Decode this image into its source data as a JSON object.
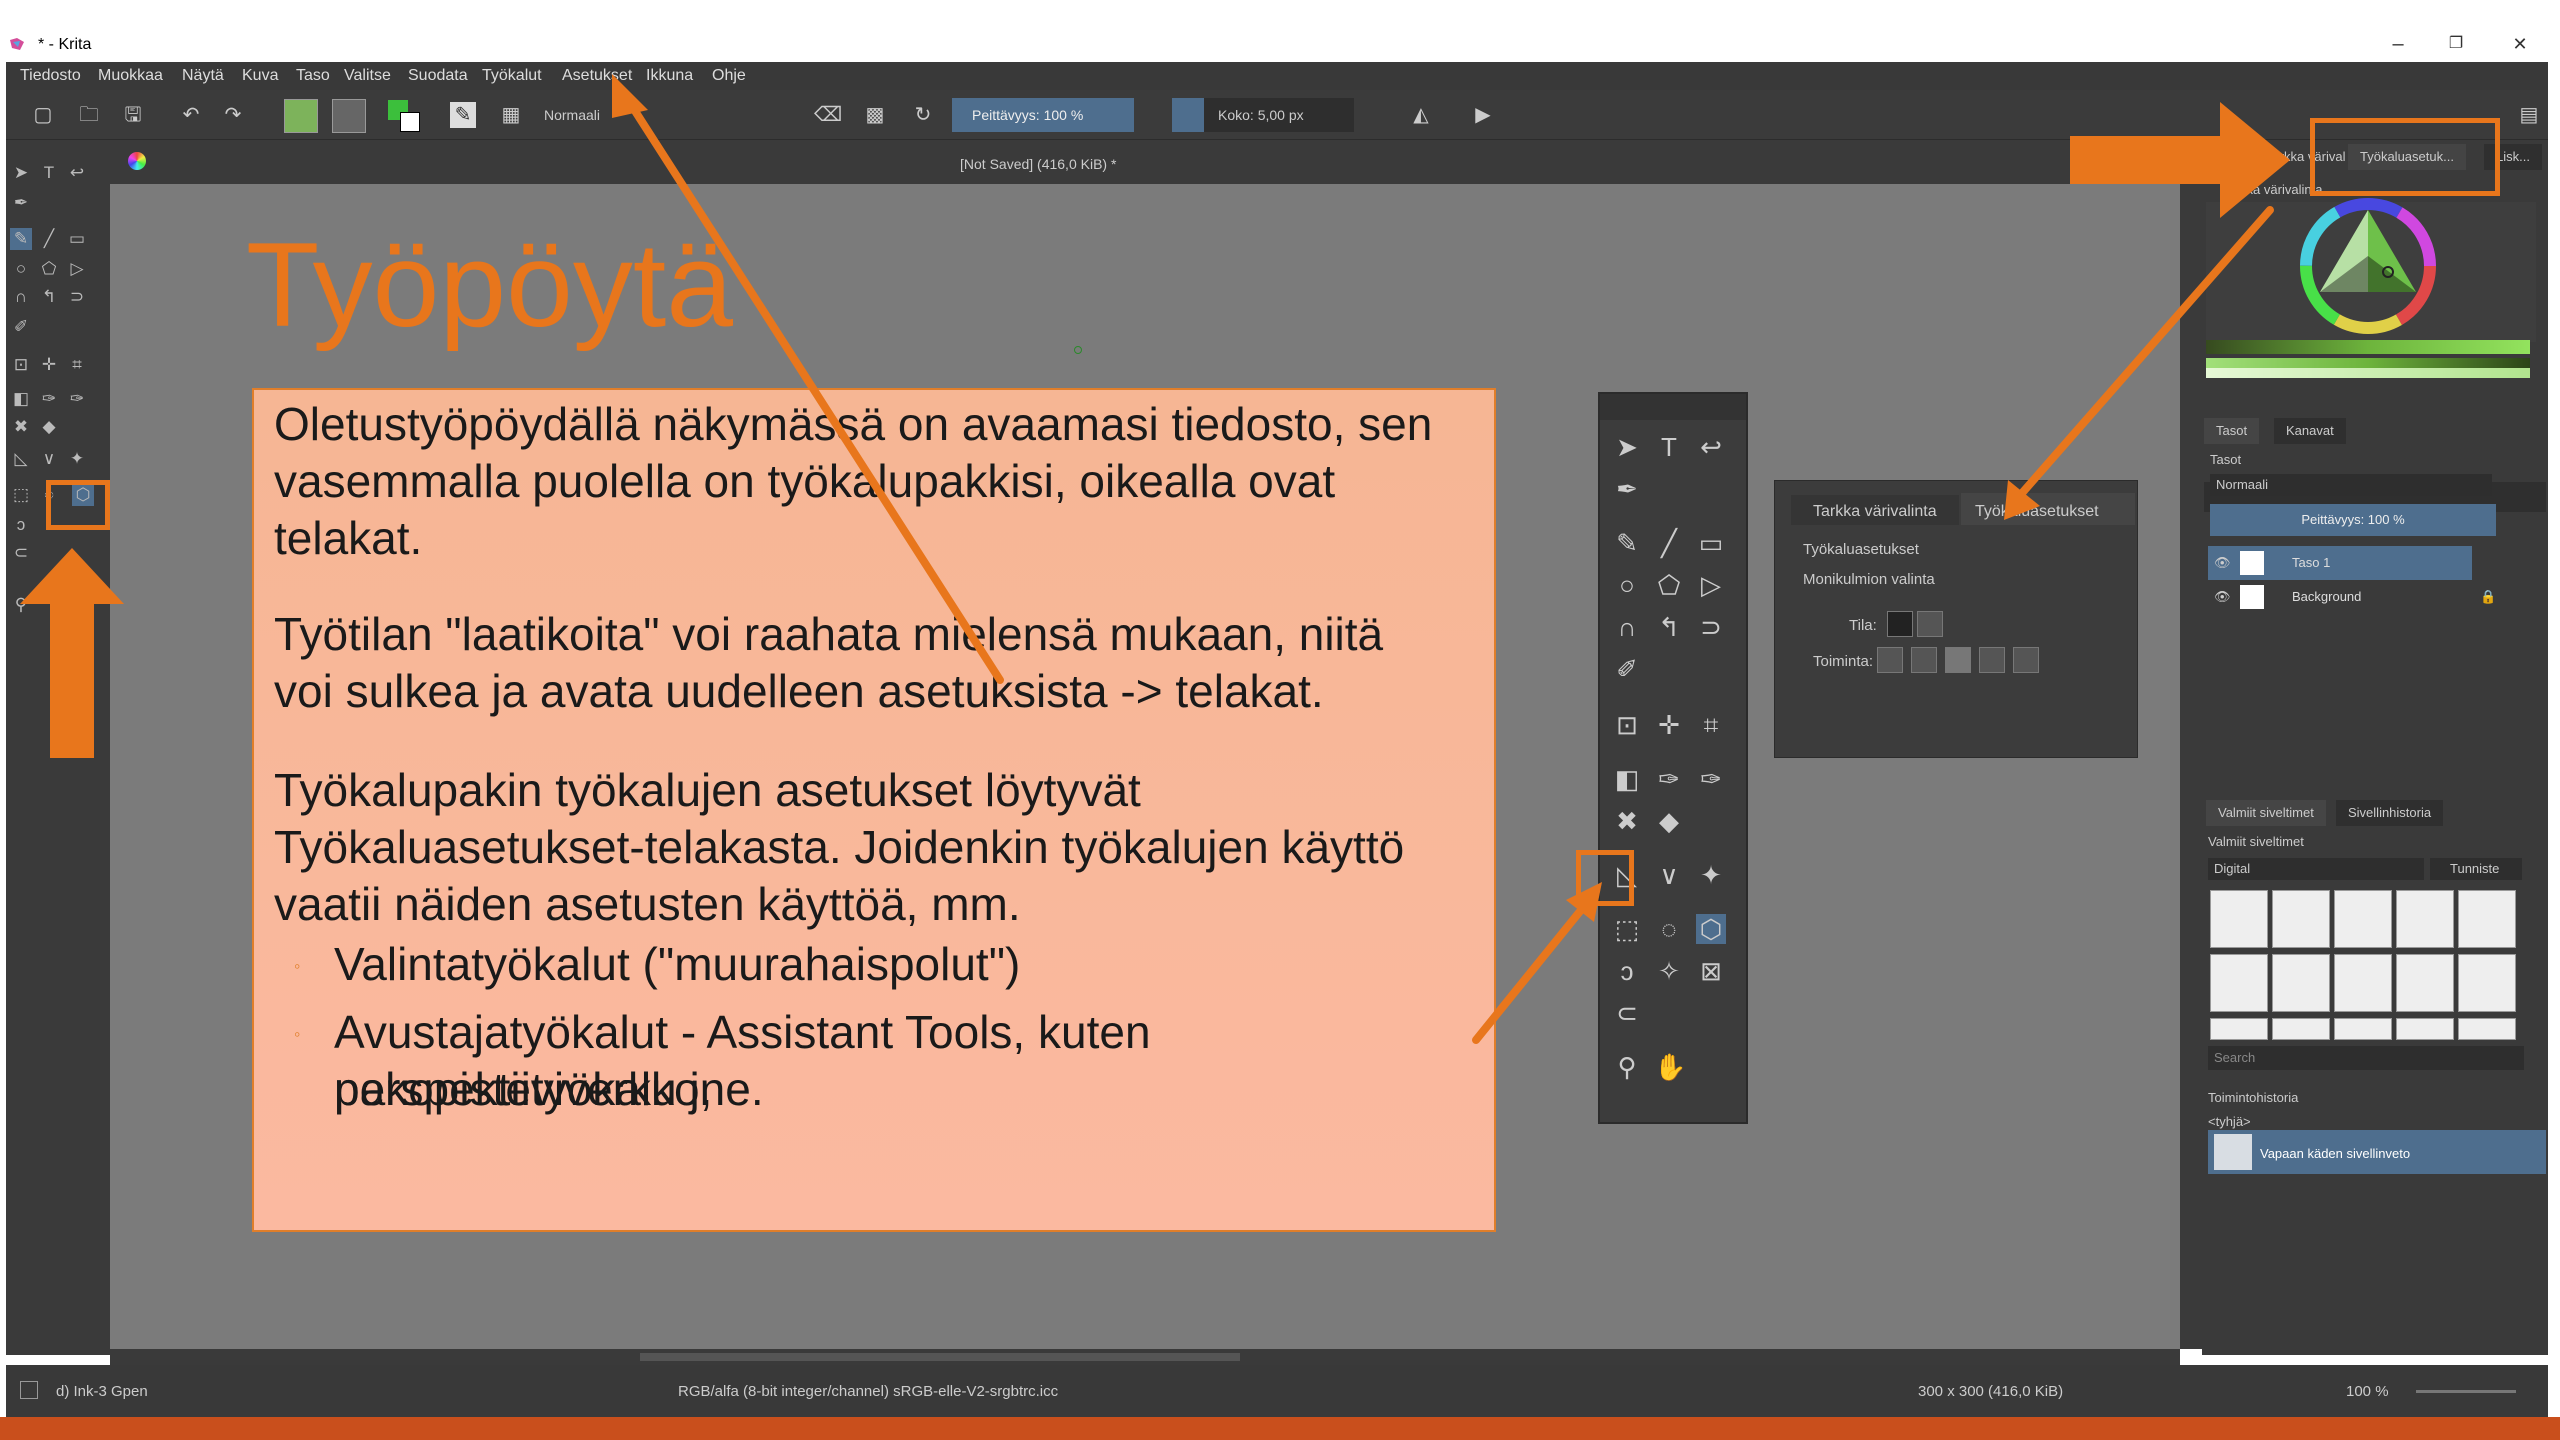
{
  "window": {
    "title": "* - Krita",
    "minimize": "–",
    "restore": "❐",
    "close": "✕"
  },
  "menu": [
    "Tiedosto",
    "Muokkaa",
    "Näytä",
    "Kuva",
    "Taso",
    "Valitse",
    "Suodata",
    "Työkalut",
    "Asetukset",
    "Ikkuna",
    "Ohje"
  ],
  "toolbar": {
    "blend_mode": "Normaali",
    "opacity": "Peittävyys: 100 %",
    "size": "Koko: 5,00 px"
  },
  "canvas": {
    "header": "[Not Saved]  (416,0 KiB) *"
  },
  "slide": {
    "title": "Työpöytä",
    "para1": [
      "Oletustyöpöydällä näkymässä on avaamasi tiedosto, sen",
      "vasemmalla puolella on työkalupakkisi, oikealla ovat",
      "telakat."
    ],
    "para2": [
      "Työtilan \"laatikoita\" voi raahata mielensä mukaan, niitä",
      "voi sulkea ja avata uudelleen asetuksista -> telakat."
    ],
    "para3": [
      "Työkalupakin työkalujen asetukset löytyvät",
      "Työkaluasetukset-telakasta. Joidenkin työkalujen käyttö",
      "vaatii näiden asetusten käyttöä, mm."
    ],
    "bullet1": "Valintatyökalut (\"muurahaispolut\")",
    "bullet2": [
      "Avustajatyökalut - Assistant Tools, kuten perspektiiviverkko,",
      "pakopistetyökalu jne."
    ]
  },
  "tool_options_float": {
    "tab1": "Tarkka värivalinta",
    "tab2": "Työkaluasetukset",
    "heading": "Työkaluasetukset",
    "tool_name": "Monikulmion valinta",
    "mode_label": "Tila:",
    "action_label": "Toiminta:"
  },
  "dock": {
    "top_tabs": [
      "Tarkka värival",
      "Työkaluasetuk...",
      "Lisk..."
    ],
    "color_label": "Tarkka värivalinta",
    "layer_tabs": [
      "Tasot",
      "Kanavat"
    ],
    "layers_title": "Tasot",
    "blend": "Normaali",
    "opacity": "Peittävyys: 100 %",
    "layers": [
      "Taso 1",
      "Background"
    ],
    "brush_tabs": [
      "Valmiit siveltimet",
      "Sivellinhistoria"
    ],
    "brush_title": "Valmiit siveltimet",
    "brush_filter": "Digital",
    "tag": "Tunniste",
    "search": "Search",
    "history_title": "Toimintohistoria",
    "history_empty": "<tyhjä>",
    "history_item": "Vapaan käden sivellinveto"
  },
  "status": {
    "brush": "d) Ink-3 Gpen",
    "color": "RGB/alfa (8-bit integer/channel)  sRGB-elle-V2-srgbtrc.icc",
    "dims": "300 x 300 (416,0 KiB)",
    "zoom": "100 %"
  },
  "colors": {
    "accent": "#e8761c",
    "band": "#c94f1c",
    "textbox": "#f8b898"
  }
}
